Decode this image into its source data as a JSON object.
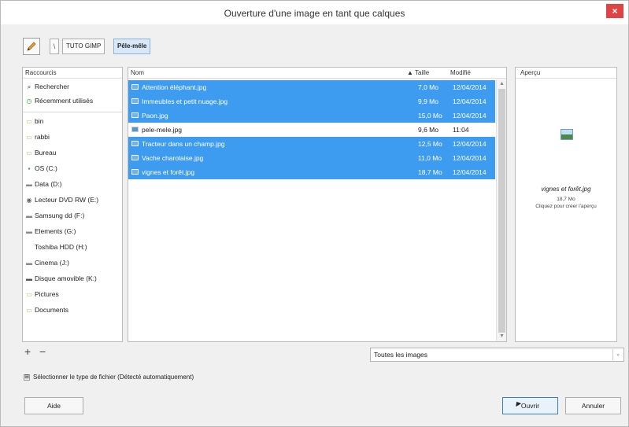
{
  "window": {
    "title": "Ouverture d'une image en tant que calques",
    "close_glyph": "×"
  },
  "pathbar": {
    "separator": "\\",
    "crumbs": [
      "TUTO GIMP",
      "Pêle-mêle"
    ],
    "active_index": 1
  },
  "places": {
    "header": "Raccourcis",
    "items": [
      {
        "icon": "search-icon",
        "glyph": "⌕",
        "label": "Rechercher"
      },
      {
        "icon": "recent-icon",
        "glyph": "◷",
        "label": "Récemment utilisés"
      },
      {
        "icon": "folder-icon",
        "glyph": "▭",
        "label": "bin"
      },
      {
        "icon": "folder-icon",
        "glyph": "▭",
        "label": "rabbi"
      },
      {
        "icon": "folder-icon",
        "glyph": "▭",
        "label": "Bureau"
      },
      {
        "icon": "drive-icon",
        "glyph": "▪",
        "label": "OS (C:)"
      },
      {
        "icon": "drive-icon",
        "glyph": "▬",
        "label": "Data (D:)"
      },
      {
        "icon": "optical-drive-icon",
        "glyph": "◉",
        "label": "Lecteur DVD RW (E:)"
      },
      {
        "icon": "drive-icon",
        "glyph": "▬",
        "label": "Samsung dd (F:)"
      },
      {
        "icon": "drive-icon",
        "glyph": "▬",
        "label": "Elements (G:)"
      },
      {
        "icon": "drive-icon",
        "glyph": "",
        "label": "Toshiba HDD (H:)"
      },
      {
        "icon": "drive-icon",
        "glyph": "▬",
        "label": "Cinema (J:)"
      },
      {
        "icon": "removable-drive-icon",
        "glyph": "▬",
        "label": "Disque amovible (K:)"
      },
      {
        "icon": "folder-icon",
        "glyph": "▭",
        "label": "Pictures"
      },
      {
        "icon": "folder-icon",
        "glyph": "▭",
        "label": "Documents"
      }
    ],
    "add_glyph": "+",
    "remove_glyph": "−"
  },
  "filelist": {
    "columns": {
      "name": "Nom",
      "size": "▲ Taille",
      "modified": "Modifié"
    },
    "rows": [
      {
        "name": "Attention éléphant.jpg",
        "size": "7,0 Mo",
        "modified": "12/04/2014",
        "selected": true
      },
      {
        "name": "Immeubles et petit nuage.jpg",
        "size": "9,9 Mo",
        "modified": "12/04/2014",
        "selected": true
      },
      {
        "name": "Paon.jpg",
        "size": "15,0 Mo",
        "modified": "12/04/2014",
        "selected": true
      },
      {
        "name": "pele-mele.jpg",
        "size": "9,6 Mo",
        "modified": "11:04",
        "selected": false
      },
      {
        "name": "Tracteur dans un champ.jpg",
        "size": "12,5 Mo",
        "modified": "12/04/2014",
        "selected": true
      },
      {
        "name": "Vache charolaise.jpg",
        "size": "11,0 Mo",
        "modified": "12/04/2014",
        "selected": true
      },
      {
        "name": "vignes et forêt.jpg",
        "size": "18,7 Mo",
        "modified": "12/04/2014",
        "selected": true
      }
    ]
  },
  "preview": {
    "header": "Aperçu",
    "filename": "vignes et forêt.jpg",
    "size": "18,7 Mo",
    "hint": "Cliquez pour créer l'aperçu"
  },
  "filter": {
    "selected": "Toutes les images",
    "arrow": "⌄"
  },
  "filetype": {
    "expander": "⊞",
    "label": "Sélectionner le type de fichier (Détecté automatiquement)"
  },
  "buttons": {
    "help": "Aide",
    "open": "Ouvrir",
    "cancel": "Annuler"
  },
  "colors": {
    "selection": "#3e9cf0",
    "close": "#e04343"
  }
}
